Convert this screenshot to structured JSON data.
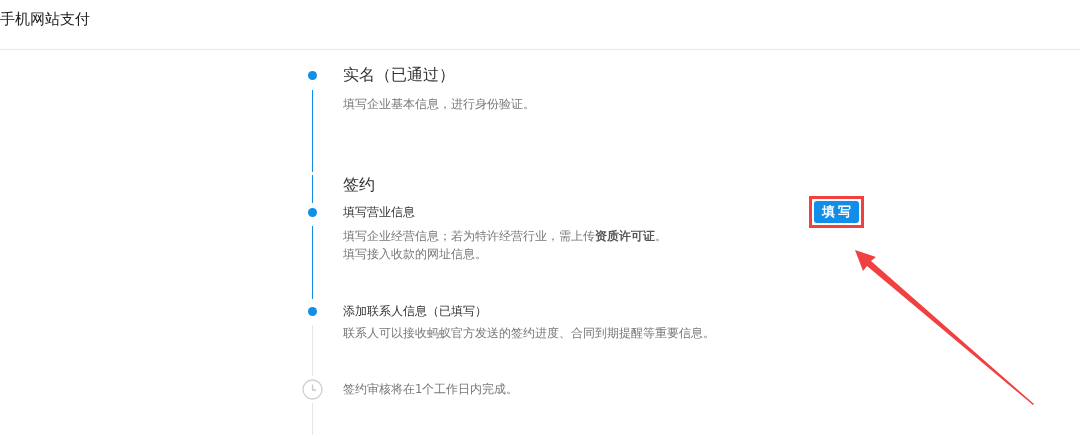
{
  "page": {
    "title": "手机网站支付"
  },
  "timeline": [
    {
      "kind": "stage",
      "done": true,
      "title": "实名（已通过）",
      "description": [
        "填写企业基本信息，进行身份验证。"
      ]
    },
    {
      "kind": "section",
      "done": true,
      "title": "签约"
    },
    {
      "kind": "task",
      "done": true,
      "title": "填写营业信息",
      "description": [
        "填写企业经营信息；若为特许经营行业，需上传**资质许可证**。",
        "填写接入收款的网址信息。"
      ],
      "action": {
        "label": "填写",
        "highlighted": true
      }
    },
    {
      "kind": "task",
      "done": true,
      "title": "添加联系人信息（已填写）",
      "description": [
        "联系人可以接收蚂蚁官方发送的签约进度、合同到期提醒等重要信息。"
      ]
    },
    {
      "kind": "pending",
      "done": false,
      "title": "签约审核将在1个工作日内完成。"
    }
  ],
  "annotations": [
    {
      "kind": "arrow"
    }
  ]
}
